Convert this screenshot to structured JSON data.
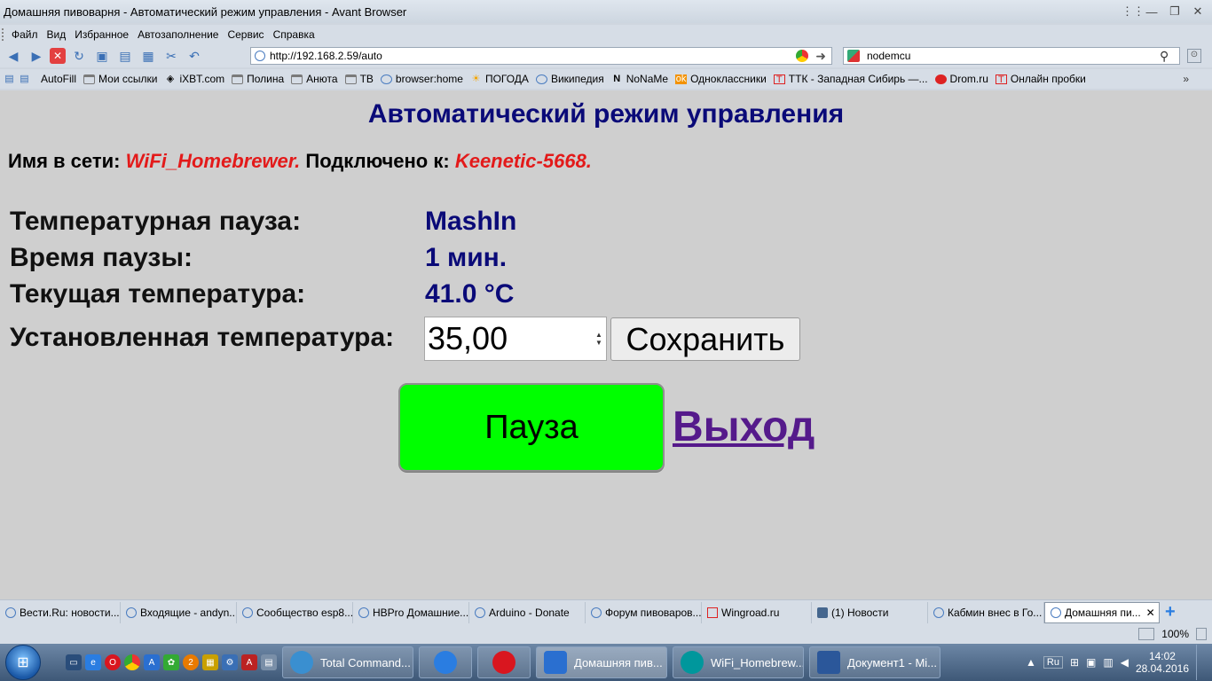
{
  "window": {
    "title": "Домашняя пивоварня - Автоматический режим управления - Avant Browser",
    "controls": [
      "⋮⋮",
      "—",
      "❐",
      "✕"
    ]
  },
  "menu": [
    "Файл",
    "Вид",
    "Избранное",
    "Автозаполнение",
    "Сервис",
    "Справка"
  ],
  "address": {
    "url": "http://192.168.2.59/auto"
  },
  "search": {
    "value": "nodemcu"
  },
  "links": [
    {
      "label": "AutoFill",
      "icon": "autofill-icon"
    },
    {
      "label": "Мои ссылки",
      "icon": "folder-icon"
    },
    {
      "label": "iXBT.com",
      "icon": "ixbt-icon"
    },
    {
      "label": "Полина",
      "icon": "folder-icon"
    },
    {
      "label": "Анюта",
      "icon": "folder-icon"
    },
    {
      "label": "ТВ",
      "icon": "folder-icon"
    },
    {
      "label": "browser:home",
      "icon": "globe-icon"
    },
    {
      "label": "ПОГОДА",
      "icon": "sun-icon"
    },
    {
      "label": "Википедия",
      "icon": "globe-icon"
    },
    {
      "label": "NoNaMe",
      "icon": "n-icon"
    },
    {
      "label": "Одноклассники",
      "icon": "ok-icon"
    },
    {
      "label": "ТТК - Западная Сибирь —...",
      "icon": "ttk-icon"
    },
    {
      "label": "Drom.ru",
      "icon": "drom-icon"
    },
    {
      "label": "Онлайн пробки",
      "icon": "ttk-icon"
    }
  ],
  "page": {
    "title": "Автоматический режим управления",
    "net_label": "Имя в сети:",
    "net_name": "WiFi_Homebrewer.",
    "connected_label": "Подключено к:",
    "connected_name": "Keenetic-5668.",
    "pause_label": "Температурная пауза:",
    "pause_value": "MashIn",
    "time_label": "Время паузы:",
    "time_value": "1 мин.",
    "current_label": "Текущая температура:",
    "current_value": "41.0 °C",
    "set_label": "Установленная температура:",
    "set_value": "35,00",
    "save_button": "Сохранить",
    "pause_button": "Пауза",
    "exit_link": "Выход"
  },
  "tabs": [
    {
      "label": "Вести.Ru: новости..."
    },
    {
      "label": "Входящие - andyn..."
    },
    {
      "label": "Сообщество esp8..."
    },
    {
      "label": "HBPro Домашние..."
    },
    {
      "label": "Arduino - Donate"
    },
    {
      "label": "Форум пивоваров..."
    },
    {
      "label": "Wingroad.ru"
    },
    {
      "label": "(1) Новости"
    },
    {
      "label": "Кабмин внес в Го..."
    },
    {
      "label": "Домашняя пи...",
      "active": true
    }
  ],
  "status": {
    "zoom": "100%"
  },
  "taskbar": {
    "tasks": [
      {
        "label": "Total Command...",
        "color": "#3a8fd0"
      },
      {
        "label": "",
        "color": "#2a7de1"
      },
      {
        "label": "",
        "color": "#d9161f"
      },
      {
        "label": "Домашняя пив...",
        "color": "#2a6fd0",
        "active": true
      },
      {
        "label": "WiFi_Homebrew...",
        "color": "#00979c"
      },
      {
        "label": "Документ1 - Mi...",
        "color": "#2b579a"
      }
    ],
    "lang": "Ru",
    "time": "14:02",
    "date": "28.04.2016"
  }
}
